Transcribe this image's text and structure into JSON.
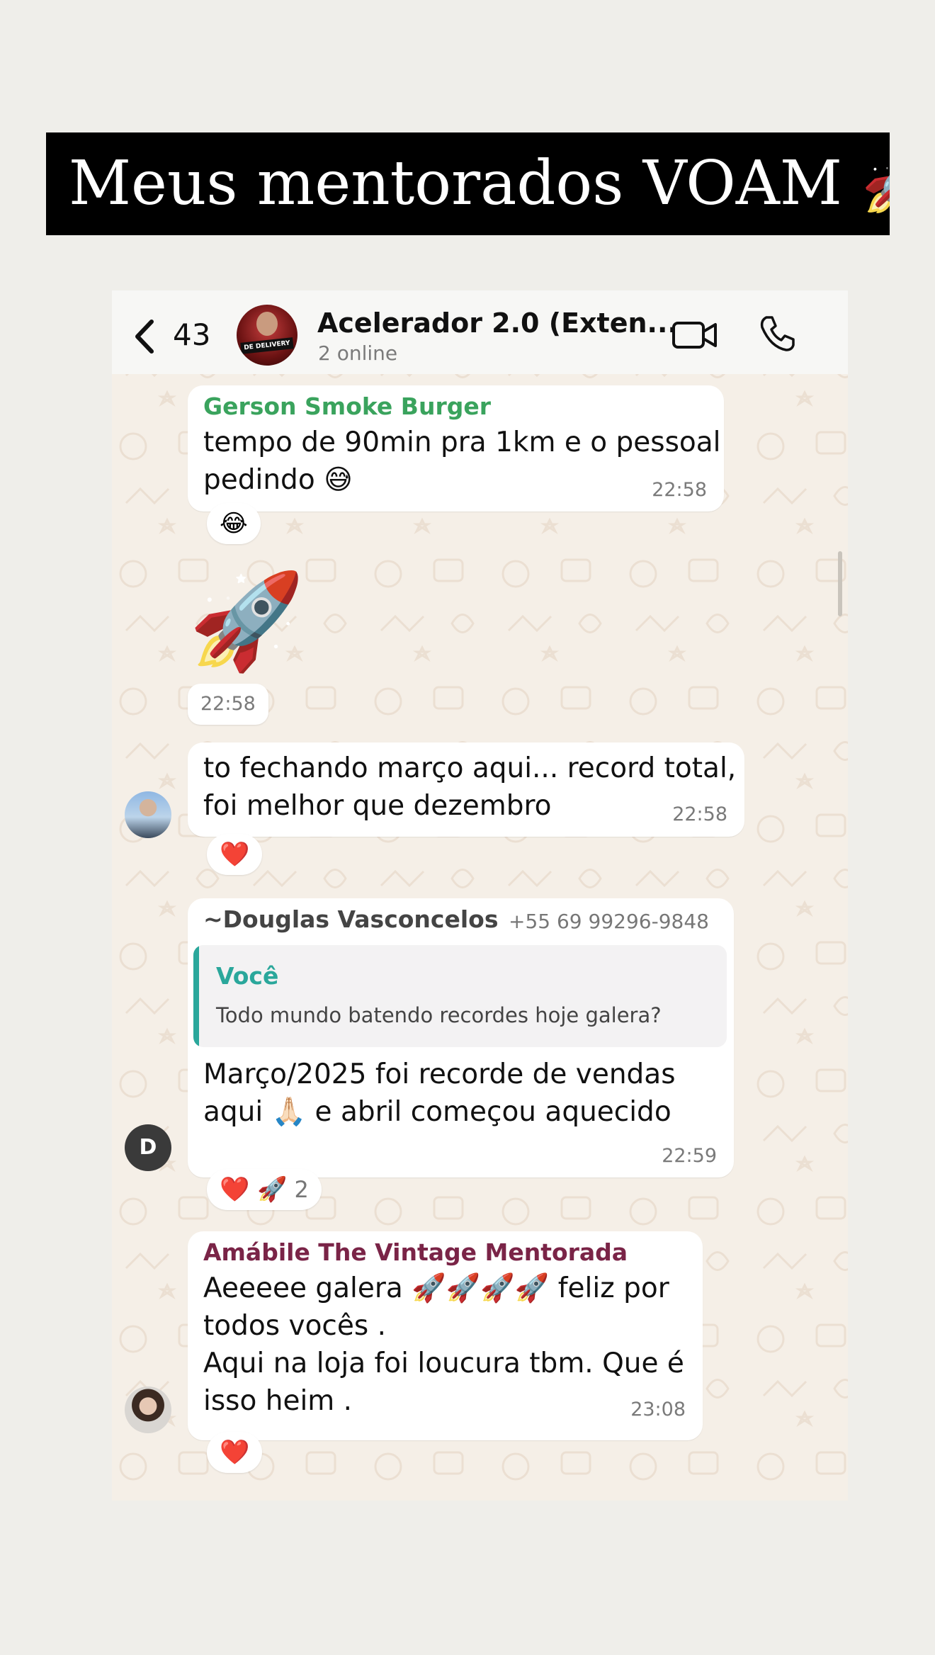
{
  "banner": {
    "text": "Meus mentorados VOAM 🚀"
  },
  "header": {
    "back_count": "43",
    "group_name": "Acelerador 2.0 (Exten...",
    "status": "2 online",
    "avatar_label": "DE DELIVERY"
  },
  "messages": [
    {
      "sender": "Gerson Smoke Burger",
      "sender_color": "#3aa35d",
      "lines": [
        "tempo de 90min pra 1km e o pessoal",
        "pedindo 😅"
      ],
      "time": "22:58",
      "reaction": "😂"
    },
    {
      "sticker": "🚀",
      "time": "22:58"
    },
    {
      "lines": [
        "to fechando março aqui... record total,",
        "foi melhor que dezembro"
      ],
      "time": "22:58",
      "reaction": "❤️"
    },
    {
      "sender_prefix": "~",
      "sender": "Douglas Vasconcelos",
      "sender_phone": "+55 69 99296-9848",
      "sender_color": "#444444",
      "quote_author": "Você",
      "quote_text": "Todo mundo batendo recordes hoje galera?",
      "lines": [
        "Março/2025 foi recorde de vendas",
        "aqui 🙏🏻 e abril começou aquecido"
      ],
      "time": "22:59",
      "reaction": "❤️ 🚀",
      "reaction_count": "2",
      "avatar_letter": "D"
    },
    {
      "sender": "Amábile The Vintage Mentorada",
      "sender_color": "#7a2447",
      "lines": [
        "Aeeeee galera 🚀🚀🚀🚀 feliz por",
        "todos vocês .",
        "Aqui na loja foi loucura tbm.  Que é",
        "isso heim ."
      ],
      "time": "23:08",
      "reaction": "❤️"
    }
  ]
}
